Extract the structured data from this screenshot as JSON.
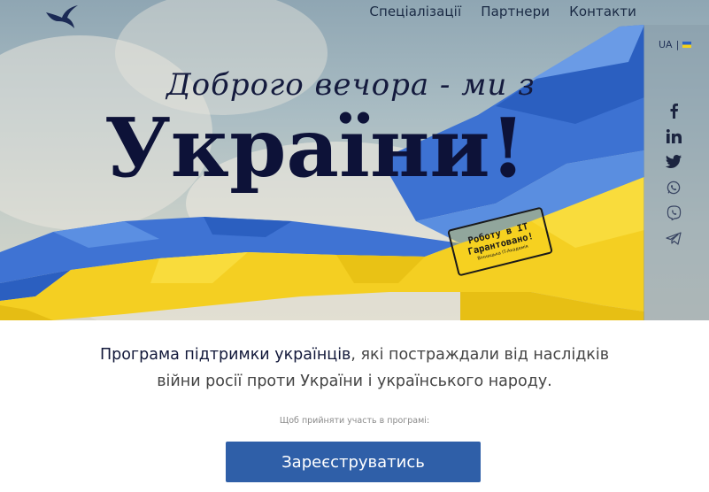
{
  "nav": {
    "links": [
      "Спеціалізації",
      "Партнери",
      "Контакти"
    ]
  },
  "lang": {
    "code": "UA",
    "separator": "|"
  },
  "social": [
    "facebook-icon",
    "linkedin-icon",
    "twitter-icon",
    "whatsapp-icon",
    "viber-icon",
    "telegram-icon"
  ],
  "hero": {
    "greeting": "Доброго вечора - ми з",
    "headline": "України!",
    "stamp": {
      "line1": "Роботу в IT",
      "line2": "Гарантовано!",
      "small": "Вінницька IT-Академія"
    }
  },
  "intro": {
    "bold": "Програма підтримки українців",
    "rest": ", які постраждали від наслідків",
    "line2": "війни росії проти України і українського народу."
  },
  "hint": "Щоб прийняти участь в програмі:",
  "register_label": "Зареєструватись",
  "colors": {
    "ukraine_blue": "#2b63c7",
    "ukraine_yellow": "#f5d21a",
    "button": "#2f5fa8",
    "headline": "#0d1238"
  }
}
